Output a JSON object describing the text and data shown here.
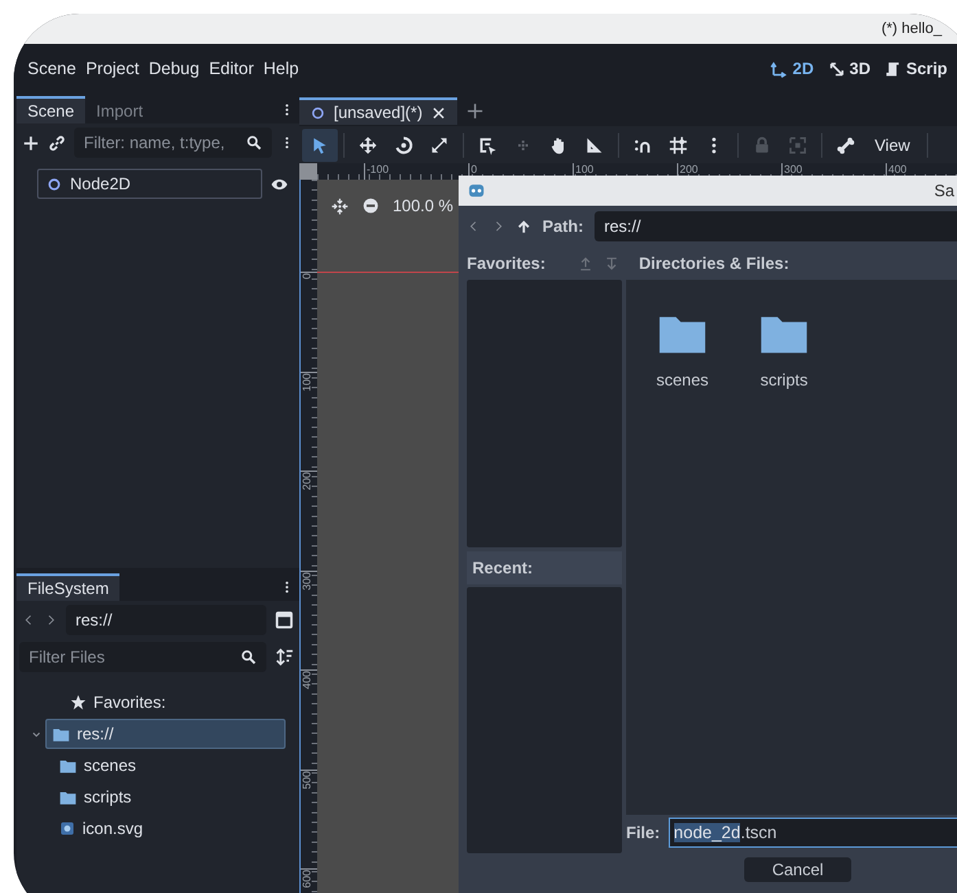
{
  "window": {
    "title": "(*) hello_"
  },
  "menu": [
    "Scene",
    "Project",
    "Debug",
    "Editor",
    "Help"
  ],
  "workspaces": [
    {
      "kind": "flat",
      "label": "2D",
      "selected": true
    },
    {
      "kind": "spatial",
      "label": "3D",
      "selected": false
    },
    {
      "kind": "script",
      "label": "Scrip",
      "selected": false
    }
  ],
  "scene_dock": {
    "tabs": [
      {
        "label": "Scene",
        "selected": true
      },
      {
        "label": "Import",
        "selected": false
      }
    ],
    "filter": {
      "placeholder": "Filter: name, t:type,"
    },
    "tree": [
      {
        "label": "Node2D",
        "visible": true
      }
    ]
  },
  "filesystem": {
    "tab": "FileSystem",
    "path": "res://",
    "filter": {
      "placeholder": "Filter Files"
    },
    "tree": [
      {
        "kind": "favorites",
        "label": "Favorites:",
        "selected": false
      },
      {
        "kind": "folder",
        "label": "res://",
        "selected": true,
        "expanded": true,
        "children": [
          {
            "kind": "folder",
            "label": "scenes",
            "selected": false
          },
          {
            "kind": "folder",
            "label": "scripts",
            "selected": false
          },
          {
            "kind": "image",
            "label": "icon.svg",
            "selected": false
          }
        ]
      }
    ]
  },
  "editor": {
    "tabs": [
      {
        "label": "[unsaved](*)",
        "selected": true
      }
    ],
    "tools": [
      {
        "kind": "select",
        "selected": true,
        "disabled": false
      },
      {
        "kind": "move",
        "selected": false,
        "disabled": false
      },
      {
        "kind": "rotate",
        "selected": false,
        "disabled": false
      },
      {
        "kind": "scale",
        "selected": false,
        "disabled": false
      },
      {
        "kind": "list",
        "selected": false,
        "disabled": false
      },
      {
        "kind": "pivot",
        "selected": false,
        "disabled": true
      },
      {
        "kind": "pan",
        "selected": false,
        "disabled": false
      },
      {
        "kind": "ruler",
        "selected": false,
        "disabled": false
      },
      {
        "kind": "snap",
        "selected": false,
        "disabled": false
      },
      {
        "kind": "grid",
        "selected": false,
        "disabled": false
      },
      {
        "kind": "more",
        "selected": false,
        "disabled": false
      },
      {
        "kind": "lock",
        "selected": false,
        "disabled": true
      },
      {
        "kind": "group",
        "selected": false,
        "disabled": true
      },
      {
        "kind": "bone",
        "selected": false,
        "disabled": false
      }
    ],
    "view_button": "View",
    "zoom": "100.0 %",
    "rulers": {
      "horizontal": [
        "-100",
        "0",
        "100",
        "200",
        "300",
        "400"
      ],
      "vertical": [
        "0",
        "100",
        "200",
        "300",
        "400",
        "500",
        "600"
      ]
    }
  },
  "dialog": {
    "title": "Sa",
    "path_label": "Path:",
    "path": "res://",
    "favorites_label": "Favorites:",
    "files_label": "Directories & Files:",
    "recent_label": "Recent:",
    "items": [
      {
        "label": "scenes",
        "selected": false
      },
      {
        "label": "scripts",
        "selected": false
      }
    ],
    "file_label": "File:",
    "file": {
      "selected_part": "node_2d",
      "rest": ".tscn"
    },
    "buttons": [
      "Cancel"
    ]
  }
}
